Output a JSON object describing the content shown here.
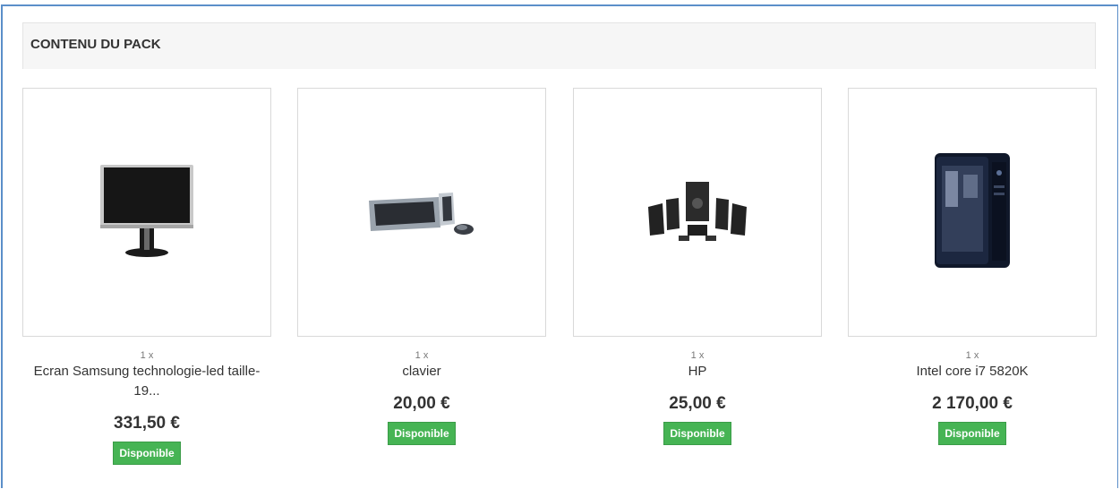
{
  "section": {
    "title": "CONTENU DU PACK"
  },
  "products": [
    {
      "quantity": "1 x",
      "name": "Ecran Samsung technologie-led taille-19...",
      "price": "331,50 €",
      "availability": "Disponible",
      "icon": "monitor-icon"
    },
    {
      "quantity": "1 x",
      "name": "clavier",
      "price": "20,00 €",
      "availability": "Disponible",
      "icon": "keyboard-icon"
    },
    {
      "quantity": "1 x",
      "name": "HP",
      "price": "25,00 €",
      "availability": "Disponible",
      "icon": "speakers-icon"
    },
    {
      "quantity": "1 x",
      "name": "Intel core i7 5820K",
      "price": "2 170,00 €",
      "availability": "Disponible",
      "icon": "pc-tower-icon"
    }
  ],
  "colors": {
    "available": "#46b454",
    "frame": "#5b8fc9",
    "header_bg": "#f6f6f6"
  }
}
